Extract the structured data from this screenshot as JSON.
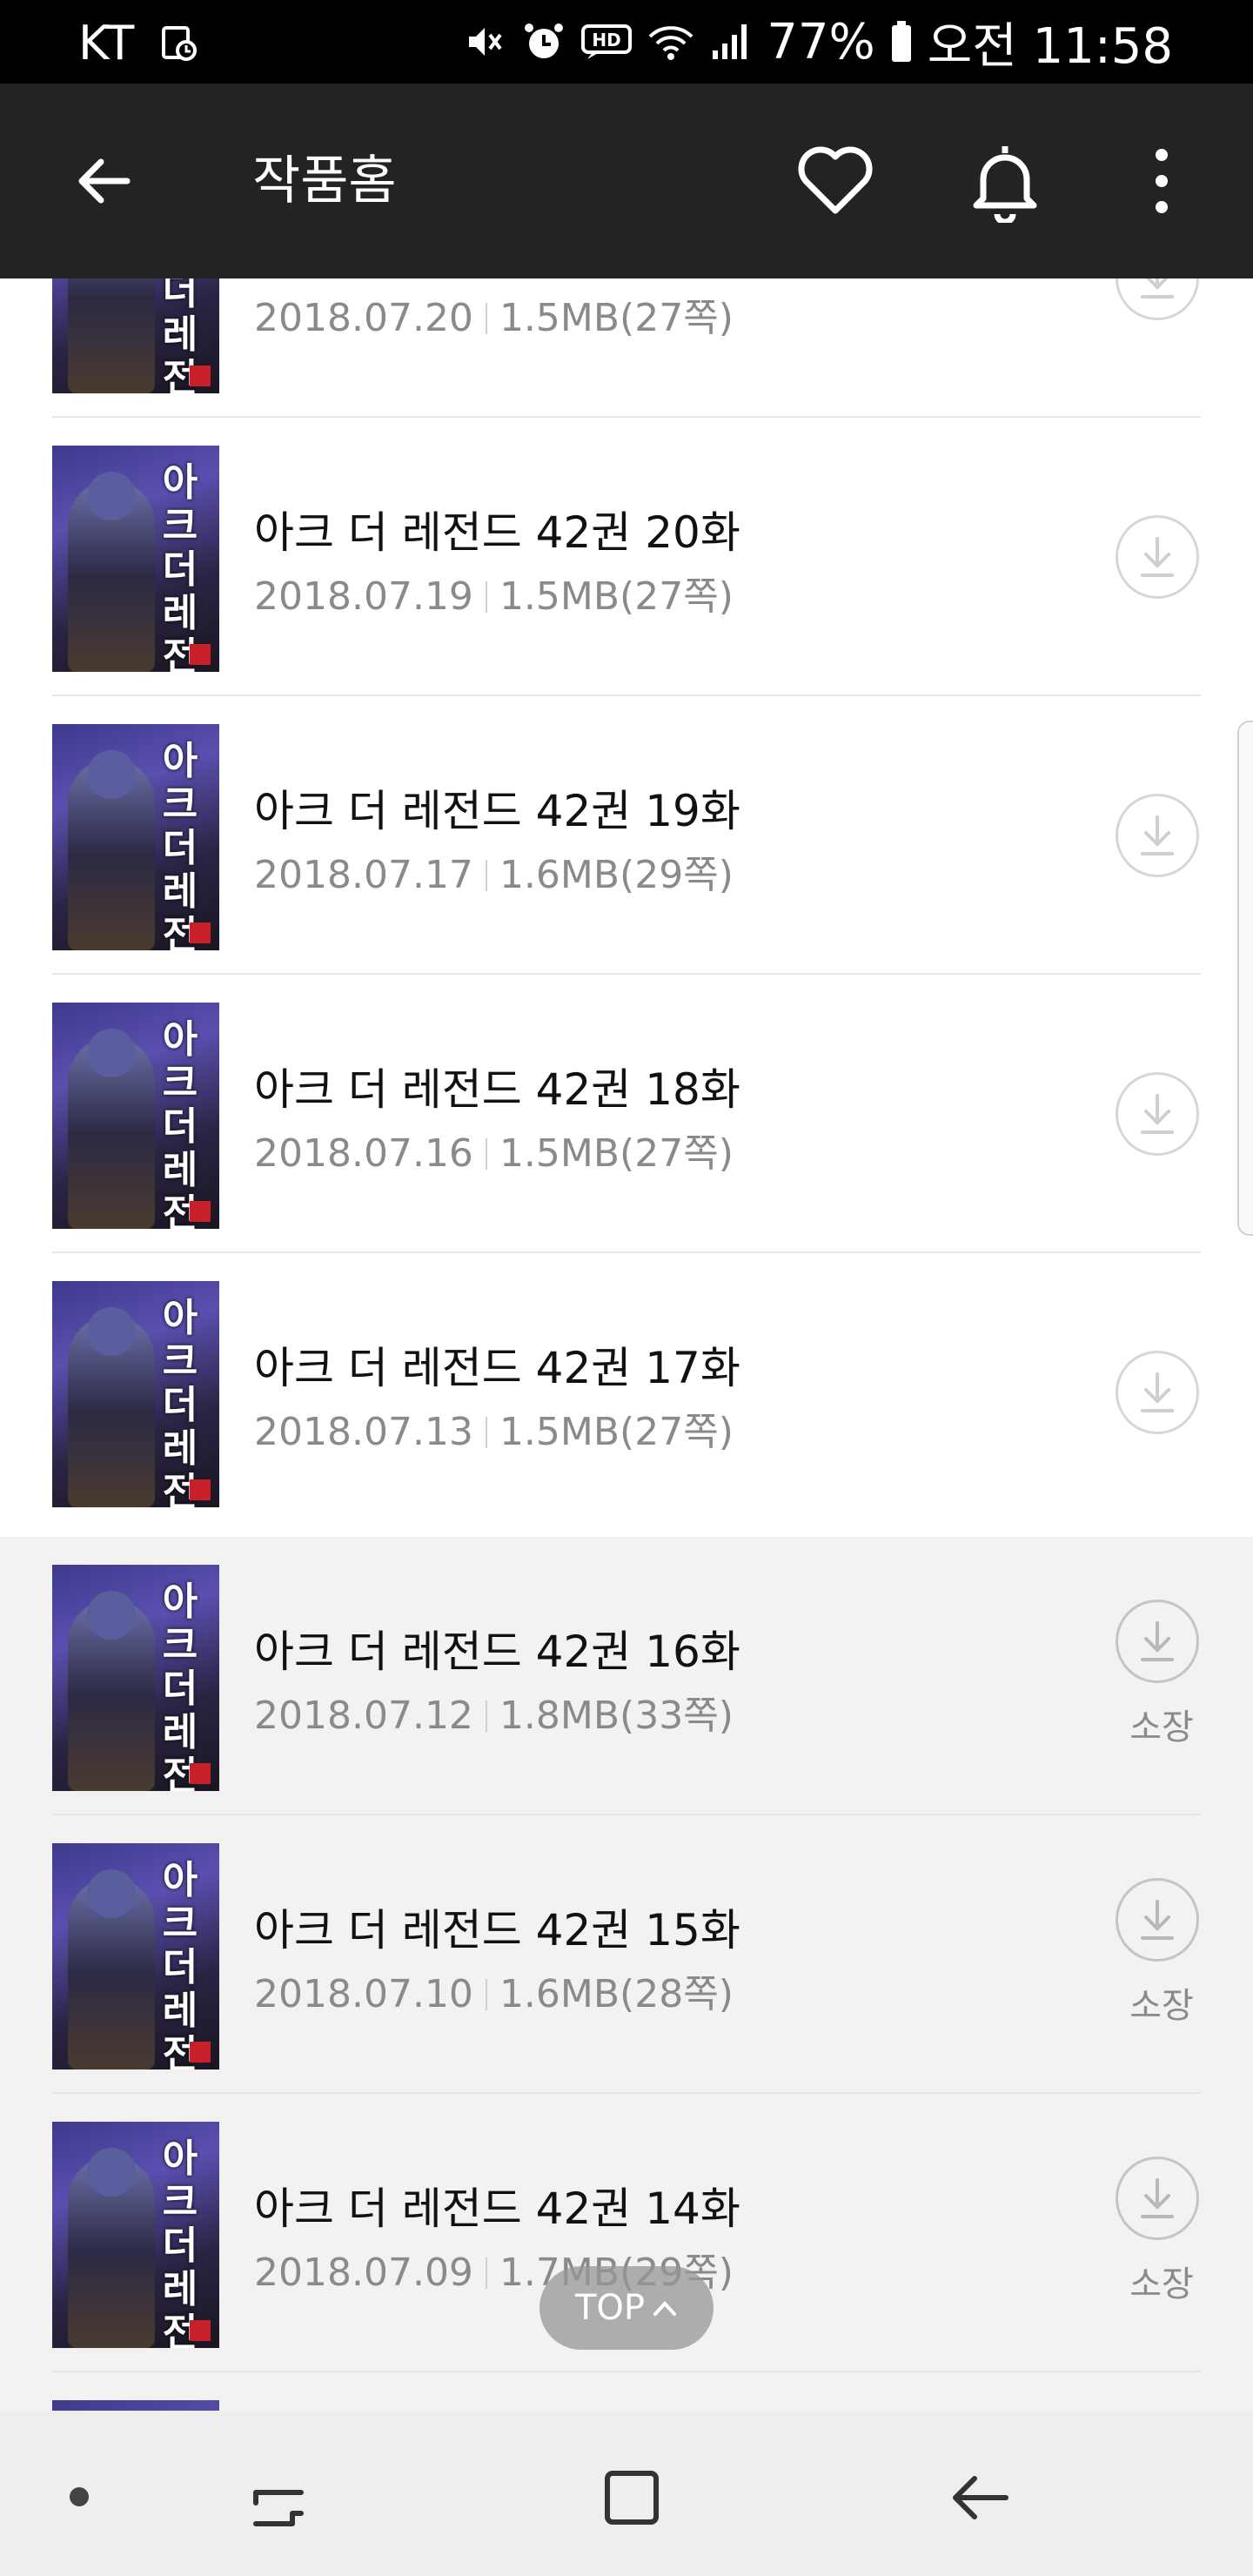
{
  "status_bar": {
    "carrier": "KT",
    "battery": "77%",
    "time": "오전 11:58",
    "icons": [
      "sync-icon",
      "mute-icon",
      "alarm-icon",
      "hd-icon",
      "wifi-icon",
      "signal-icon",
      "battery-icon"
    ]
  },
  "app_bar": {
    "title": "작품홈",
    "icons": [
      "back-arrow-icon",
      "heart-icon",
      "bell-icon",
      "more-vert-icon"
    ]
  },
  "thumbnail": {
    "cover_title": "아크 더 레전드"
  },
  "episodes": [
    {
      "title": "",
      "date": "2018.07.20",
      "size": "1.5MB(27쪽)",
      "owned": false
    },
    {
      "title": "아크 더 레전드 42권 20화",
      "date": "2018.07.19",
      "size": "1.5MB(27쪽)",
      "owned": false
    },
    {
      "title": "아크 더 레전드 42권 19화",
      "date": "2018.07.17",
      "size": "1.6MB(29쪽)",
      "owned": false
    },
    {
      "title": "아크 더 레전드 42권 18화",
      "date": "2018.07.16",
      "size": "1.5MB(27쪽)",
      "owned": false
    },
    {
      "title": "아크 더 레전드 42권 17화",
      "date": "2018.07.13",
      "size": "1.5MB(27쪽)",
      "owned": false
    },
    {
      "title": "아크 더 레전드 42권 16화",
      "date": "2018.07.12",
      "size": "1.8MB(33쪽)",
      "owned": true,
      "owned_label": "소장"
    },
    {
      "title": "아크 더 레전드 42권 15화",
      "date": "2018.07.10",
      "size": "1.6MB(28쪽)",
      "owned": true,
      "owned_label": "소장"
    },
    {
      "title": "아크 더 레전드 42권 14화",
      "date": "2018.07.09",
      "size": "1.7MB(29쪽)",
      "owned": true,
      "owned_label": "소장"
    }
  ],
  "top_button": {
    "label": "TOP"
  },
  "colors": {
    "status_bar_bg": "#000000",
    "app_bar_bg": "#232323",
    "owned_row_bg": "#f2f2f2",
    "meta_text": "#8a8a8a",
    "nav_bar_bg": "#eeeeee"
  },
  "nav_bar": {
    "icons": [
      "dot-icon",
      "recent-apps-icon",
      "home-icon",
      "back-icon"
    ]
  }
}
